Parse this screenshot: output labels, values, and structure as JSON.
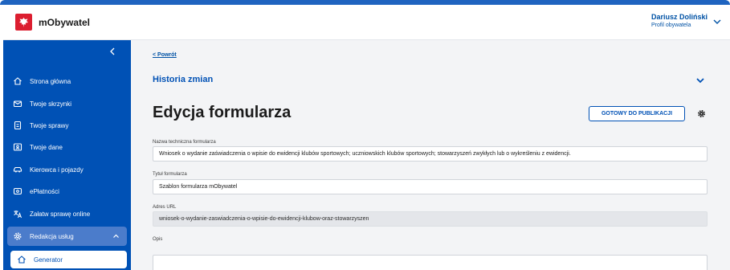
{
  "header": {
    "app_title": "mObywatel",
    "user_name": "Dariusz Doliński",
    "user_role": "Profil obywatela"
  },
  "sidebar": {
    "collapse_icon": "chevron-left-icon",
    "items": [
      {
        "label": "Strona główna",
        "icon": "home-icon"
      },
      {
        "label": "Twoje skrzynki",
        "icon": "mail-icon"
      },
      {
        "label": "Twoje sprawy",
        "icon": "document-icon"
      },
      {
        "label": "Twoje dane",
        "icon": "id-card-icon"
      },
      {
        "label": "Kierowca i pojazdy",
        "icon": "car-icon"
      },
      {
        "label": "ePłatności",
        "icon": "card-icon"
      },
      {
        "label": "Załatw sprawę online",
        "icon": "translate-icon"
      }
    ],
    "group": {
      "label": "Redakcja usług",
      "icon": "gear-icon"
    },
    "sub_item": {
      "label": "Generator",
      "icon": "home-icon"
    }
  },
  "main": {
    "back_link": "< Powrót",
    "history_label": "Historia zmian",
    "page_title": "Edycja formularza",
    "publish_button": "GOTOWY DO PUBLIKACJI",
    "fields": {
      "technical_name": {
        "label": "Nazwa techniczna formularza",
        "value": "Wniosek o wydanie zaświadczenia o wpisie do ewidencji klubów sportowych; uczniowskich klubów sportowych; stowarzyszeń zwykłych lub o wykreśleniu z ewidencji."
      },
      "form_title": {
        "label": "Tytuł formularza",
        "value": "Szablon formularza mObywatel"
      },
      "url": {
        "label": "Adres URL",
        "value": "wniosek-o-wydanie-zaswiadczenia-o-wpisie-do-ewidencji-klubow-oraz-stowarzyszen"
      },
      "description": {
        "label": "Opis",
        "value": ""
      }
    }
  },
  "colors": {
    "sidebar": "#0051b5",
    "accent": "#0052a5",
    "group_bg": "#4b7ccb",
    "logo": "#dc1e30",
    "main_bg": "#f3f4f6"
  }
}
